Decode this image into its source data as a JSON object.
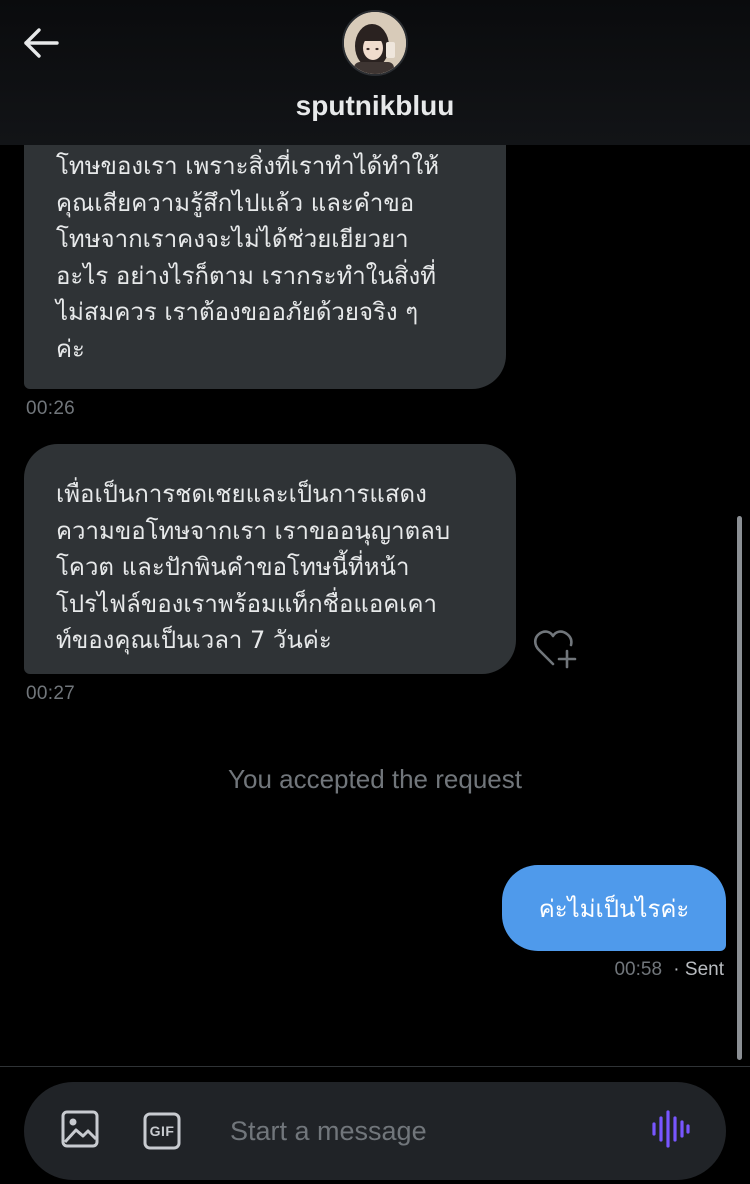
{
  "header": {
    "username": "sputnikbluu",
    "back_icon": "arrow-left-icon"
  },
  "messages": [
    {
      "direction": "incoming",
      "lines": [
        "โทษของเรา เพราะสิ่งที่เราทำได้ทำให้",
        "คุณเสียความรู้สึกไปแล้ว และคำขอ",
        "โทษจากเราคงจะไม่ได้ช่วยเยียวยา",
        "อะไร อย่างไรก็ตาม เรากระทำในสิ่งที่",
        "ไม่สมควร เราต้องขออภัยด้วยจริง ๆ",
        "ค่ะ"
      ],
      "time": "00:26"
    },
    {
      "direction": "incoming",
      "lines": [
        "เพื่อเป็นการชดเชยและเป็นการแสดง",
        "ความขอโทษจากเรา เราขออนุญาตลบ",
        "โควต และปักพินคำขอโทษนี้ที่หน้า",
        "โปรไฟล์ของเราพร้อมแท็กชื่อแอคเคา",
        "ท์ของคุณเป็นเวลา 7 วันค่ะ"
      ],
      "time": "00:27"
    }
  ],
  "system_message": "You accepted the request",
  "outgoing": {
    "text": "ค่ะไม่เป็นไรค่ะ",
    "time": "00:58",
    "status": "· Sent"
  },
  "composer": {
    "placeholder": "Start a message",
    "gif_label": "GIF",
    "icons": [
      "image-icon",
      "gif-icon",
      "voice-message-icon"
    ]
  },
  "colors": {
    "background": "#000000",
    "incoming_bubble": "#2f3336",
    "outgoing_bubble": "#4f9aeb",
    "muted_text": "#71767b",
    "accent_voice": "#7856ff"
  }
}
